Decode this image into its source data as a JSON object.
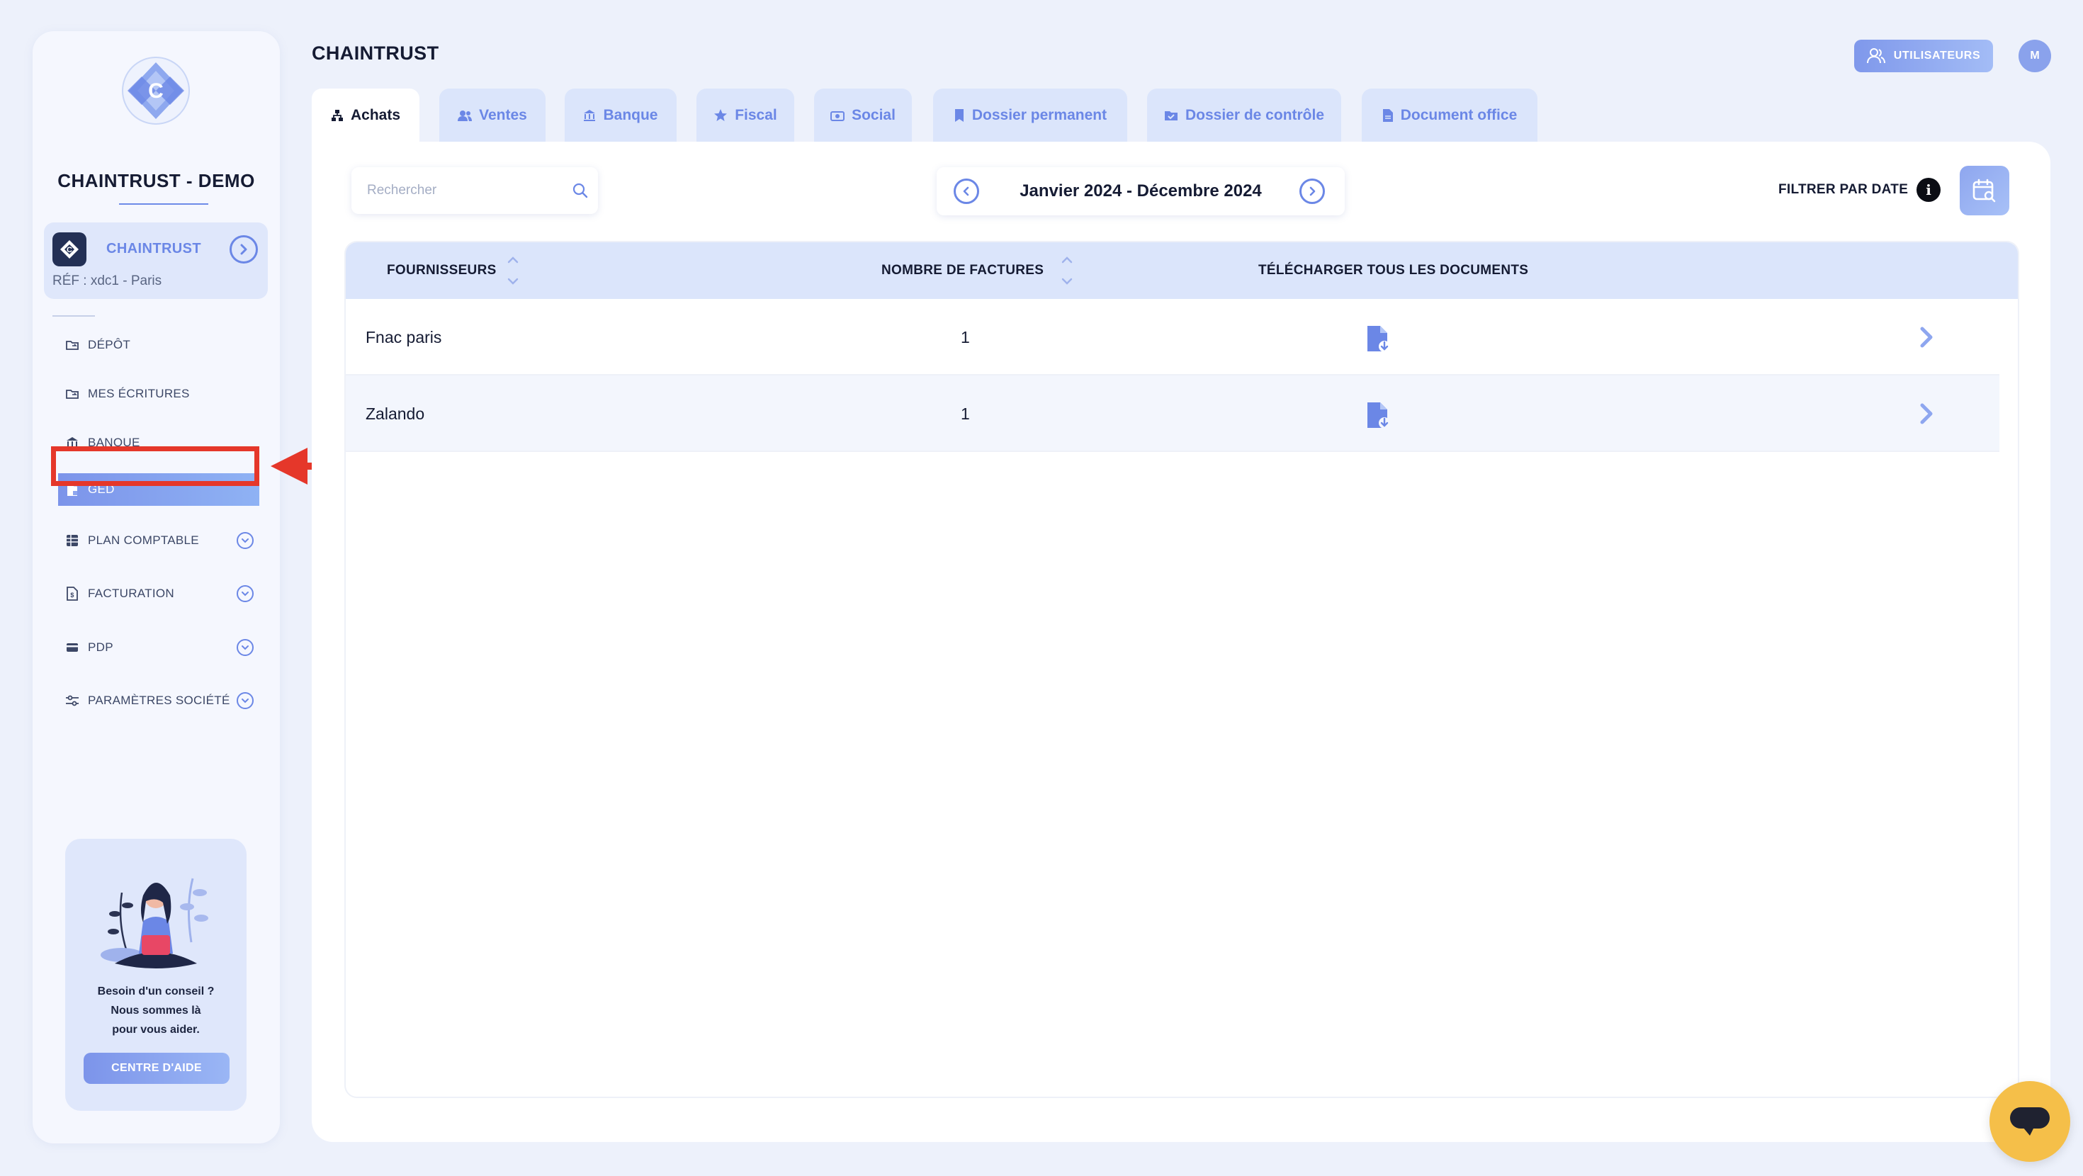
{
  "sidebar": {
    "company_title": "CHAINTRUST - DEMO",
    "company_card": {
      "name": "CHAINTRUST",
      "ref": "RÉF : xdc1 - Paris"
    },
    "items": [
      {
        "label": "DÉPÔT",
        "icon": "folder-sync-icon",
        "active": false,
        "expandable": false
      },
      {
        "label": "MES ÉCRITURES",
        "icon": "folder-sync-icon",
        "active": false,
        "expandable": false
      },
      {
        "label": "BANQUE",
        "icon": "bank-icon",
        "active": false,
        "expandable": false
      },
      {
        "label": "GED",
        "icon": "document-icon",
        "active": true,
        "expandable": false
      },
      {
        "label": "PLAN COMPTABLE",
        "icon": "table-icon",
        "active": false,
        "expandable": true
      },
      {
        "label": "FACTURATION",
        "icon": "invoice-icon",
        "active": false,
        "expandable": true
      },
      {
        "label": "PDP",
        "icon": "card-icon",
        "active": false,
        "expandable": true
      },
      {
        "label": "PARAMÈTRES SOCIÉTÉ",
        "icon": "sliders-icon",
        "active": false,
        "expandable": true
      }
    ],
    "help": {
      "line1": "Besoin d'un conseil ?",
      "line2": "Nous sommes là",
      "line3": "pour vous aider.",
      "button": "CENTRE D'AIDE"
    }
  },
  "header": {
    "title": "CHAINTRUST",
    "users_button": "UTILISATEURS",
    "avatar_initial": "M"
  },
  "tabs": [
    {
      "label": "Achats",
      "icon": "sitemap-icon",
      "active": true
    },
    {
      "label": "Ventes",
      "icon": "users-icon",
      "active": false
    },
    {
      "label": "Banque",
      "icon": "bank-icon",
      "active": false
    },
    {
      "label": "Fiscal",
      "icon": "star-icon",
      "active": false
    },
    {
      "label": "Social",
      "icon": "social-icon",
      "active": false
    },
    {
      "label": "Dossier permanent",
      "icon": "bookmark-icon",
      "active": false
    },
    {
      "label": "Dossier de contrôle",
      "icon": "folder-check-icon",
      "active": false
    },
    {
      "label": "Document office",
      "icon": "file-icon",
      "active": false
    }
  ],
  "toolbar": {
    "search_placeholder": "Rechercher",
    "search_value": "",
    "date_range": "Janvier 2024 - Décembre 2024",
    "filter_label": "FILTRER PAR DATE",
    "info_symbol": "i"
  },
  "table": {
    "columns": [
      "FOURNISSEURS",
      "NOMBRE DE FACTURES",
      "TÉLÉCHARGER TOUS LES DOCUMENTS"
    ],
    "rows": [
      {
        "supplier": "Fnac paris",
        "count": "1"
      },
      {
        "supplier": "Zalando",
        "count": "1"
      }
    ]
  },
  "colors": {
    "accent": "#6b87e6",
    "highlight": "#e5372a",
    "chat": "#f5bf49"
  }
}
